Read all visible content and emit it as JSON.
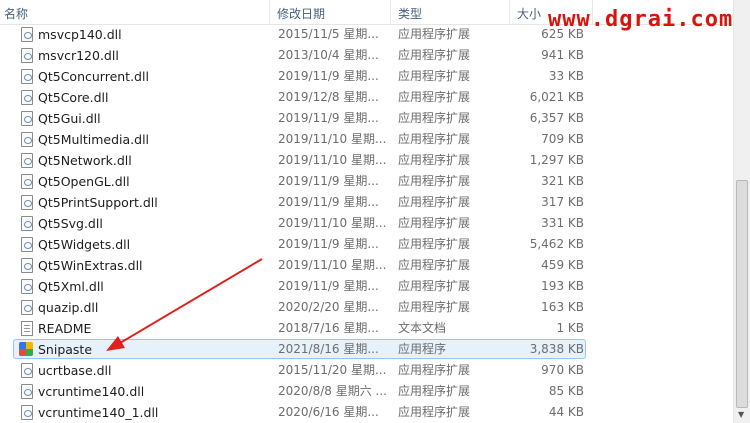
{
  "watermark": "www.dgrai.com",
  "columns": {
    "name": "名称",
    "date": "修改日期",
    "type": "类型",
    "size": "大小"
  },
  "icons": {
    "sort": "chevron-up-icon",
    "dll": "dll-file-icon",
    "txt": "text-file-icon",
    "app": "snipaste-app-icon"
  },
  "accent": {
    "selection_bg": "#e5f1fb",
    "selection_border": "#9ac5ee",
    "arrow": "#e0201b"
  },
  "files": [
    {
      "name": "msvcp140.dll",
      "date": "2015/11/5 星期...",
      "type": "应用程序扩展",
      "size": "625 KB",
      "kind": "dll"
    },
    {
      "name": "msvcr120.dll",
      "date": "2013/10/4 星期...",
      "type": "应用程序扩展",
      "size": "941 KB",
      "kind": "dll"
    },
    {
      "name": "Qt5Concurrent.dll",
      "date": "2019/11/9 星期...",
      "type": "应用程序扩展",
      "size": "33 KB",
      "kind": "dll"
    },
    {
      "name": "Qt5Core.dll",
      "date": "2019/12/8 星期...",
      "type": "应用程序扩展",
      "size": "6,021 KB",
      "kind": "dll"
    },
    {
      "name": "Qt5Gui.dll",
      "date": "2019/11/9 星期...",
      "type": "应用程序扩展",
      "size": "6,357 KB",
      "kind": "dll"
    },
    {
      "name": "Qt5Multimedia.dll",
      "date": "2019/11/10 星期...",
      "type": "应用程序扩展",
      "size": "709 KB",
      "kind": "dll"
    },
    {
      "name": "Qt5Network.dll",
      "date": "2019/11/10 星期...",
      "type": "应用程序扩展",
      "size": "1,297 KB",
      "kind": "dll"
    },
    {
      "name": "Qt5OpenGL.dll",
      "date": "2019/11/9 星期...",
      "type": "应用程序扩展",
      "size": "321 KB",
      "kind": "dll"
    },
    {
      "name": "Qt5PrintSupport.dll",
      "date": "2019/11/9 星期...",
      "type": "应用程序扩展",
      "size": "317 KB",
      "kind": "dll"
    },
    {
      "name": "Qt5Svg.dll",
      "date": "2019/11/10 星期...",
      "type": "应用程序扩展",
      "size": "331 KB",
      "kind": "dll"
    },
    {
      "name": "Qt5Widgets.dll",
      "date": "2019/11/9 星期...",
      "type": "应用程序扩展",
      "size": "5,462 KB",
      "kind": "dll"
    },
    {
      "name": "Qt5WinExtras.dll",
      "date": "2019/11/10 星期...",
      "type": "应用程序扩展",
      "size": "459 KB",
      "kind": "dll"
    },
    {
      "name": "Qt5Xml.dll",
      "date": "2019/11/9 星期...",
      "type": "应用程序扩展",
      "size": "193 KB",
      "kind": "dll"
    },
    {
      "name": "quazip.dll",
      "date": "2020/2/20 星期...",
      "type": "应用程序扩展",
      "size": "163 KB",
      "kind": "dll"
    },
    {
      "name": "README",
      "date": "2018/7/16 星期...",
      "type": "文本文档",
      "size": "1 KB",
      "kind": "txt"
    },
    {
      "name": "Snipaste",
      "date": "2021/8/16 星期...",
      "type": "应用程序",
      "size": "3,838 KB",
      "kind": "app",
      "selected": true
    },
    {
      "name": "ucrtbase.dll",
      "date": "2015/11/20 星期...",
      "type": "应用程序扩展",
      "size": "970 KB",
      "kind": "dll"
    },
    {
      "name": "vcruntime140.dll",
      "date": "2020/8/8 星期六 ...",
      "type": "应用程序扩展",
      "size": "85 KB",
      "kind": "dll"
    },
    {
      "name": "vcruntime140_1.dll",
      "date": "2020/6/16 星期...",
      "type": "应用程序扩展",
      "size": "44 KB",
      "kind": "dll"
    }
  ]
}
